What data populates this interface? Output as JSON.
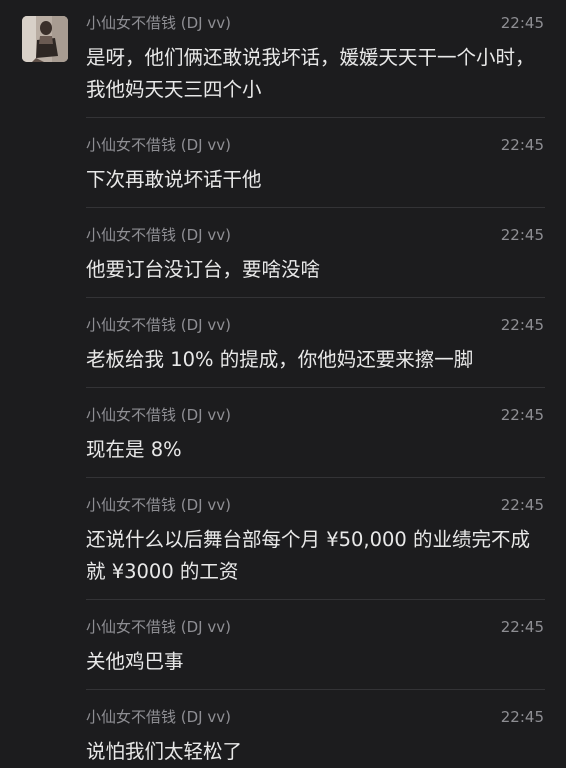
{
  "messages": [
    {
      "sender": "小仙女不借钱 (DJ vv)",
      "time": "22:45",
      "text": "是呀，他们俩还敢说我坏话，媛媛天天干一个小时，我他妈天天三四个小"
    },
    {
      "sender": "小仙女不借钱 (DJ vv)",
      "time": "22:45",
      "text": "下次再敢说坏话干他"
    },
    {
      "sender": "小仙女不借钱 (DJ vv)",
      "time": "22:45",
      "text": "他要订台没订台，要啥没啥"
    },
    {
      "sender": "小仙女不借钱 (DJ vv)",
      "time": "22:45",
      "text": "老板给我 10% 的提成，你他妈还要来擦一脚"
    },
    {
      "sender": "小仙女不借钱 (DJ vv)",
      "time": "22:45",
      "text": "现在是 8%"
    },
    {
      "sender": "小仙女不借钱 (DJ vv)",
      "time": "22:45",
      "text": "还说什么以后舞台部每个月 ¥50,000 的业绩完不成就 ¥3000 的工资"
    },
    {
      "sender": "小仙女不借钱 (DJ vv)",
      "time": "22:45",
      "text": "关他鸡巴事"
    },
    {
      "sender": "小仙女不借钱 (DJ vv)",
      "time": "22:45",
      "text": "说怕我们太轻松了"
    }
  ]
}
